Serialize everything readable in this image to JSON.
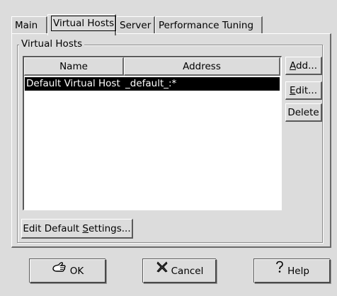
{
  "tabs": {
    "main": "Main",
    "virtual_hosts": "Virtual Hosts",
    "server": "Server",
    "performance": "Performance Tuning"
  },
  "frame": {
    "label": "Virtual Hosts"
  },
  "list": {
    "columns": [
      "Name",
      "Address"
    ],
    "rows": [
      {
        "name": "Default Virtual Host",
        "address": "_default_:*",
        "selected": true
      }
    ]
  },
  "side_buttons": {
    "add": {
      "mnemonic": "A",
      "rest": "dd..."
    },
    "edit": {
      "mnemonic": "E",
      "rest": "dit..."
    },
    "delete": "Delete"
  },
  "edit_default": {
    "prefix": "Edit Default ",
    "mnemonic": "S",
    "rest": "ettings..."
  },
  "dialog_buttons": {
    "ok": {
      "label": "OK",
      "icon": "ok-hand-icon"
    },
    "cancel": {
      "label": "Cancel",
      "icon": "cancel-x-icon"
    },
    "help": {
      "label": "Help",
      "icon": "help-question-icon"
    }
  },
  "colors": {
    "background": "#dcdcdc",
    "selection": "#000000",
    "selection_text": "#ffffff"
  }
}
